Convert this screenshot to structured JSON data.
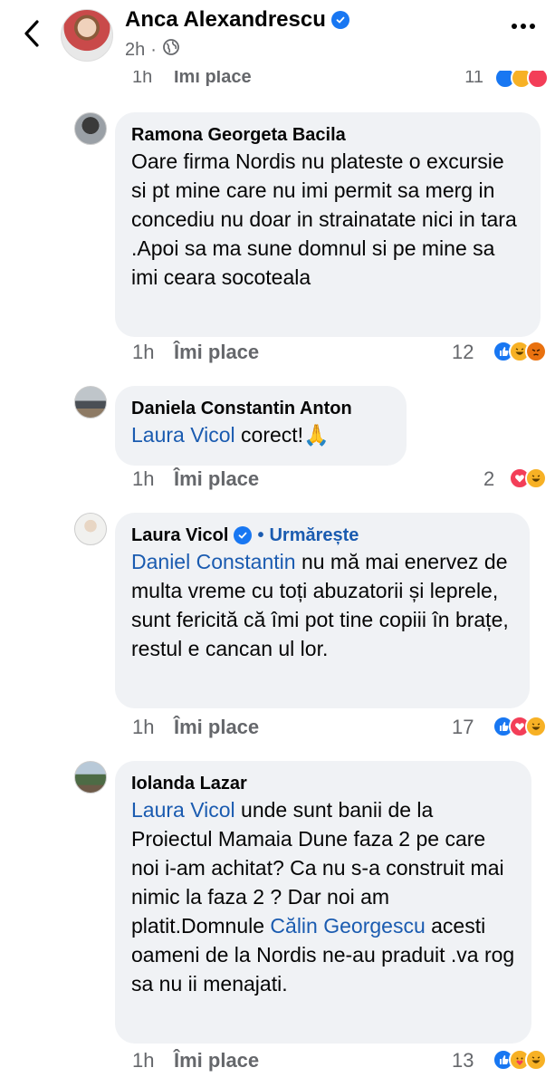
{
  "header": {
    "name": "Anca Alexandrescu",
    "time": "2h",
    "more_label": "More options"
  },
  "cut_row": {
    "time": "1h",
    "like": "Îmi place",
    "count": "11"
  },
  "comments": [
    {
      "author": "Ramona Georgeta Bacila",
      "text": "Oare firma Nordis nu plateste o excursie si pt mine care nu imi permit sa merg in concediu nu doar in strainatate nici in tara .Apoi sa ma sune domnul si pe mine sa imi ceara socoteala",
      "time": "1h",
      "like": "Îmi place",
      "count": "12",
      "reactions": [
        "like",
        "haha",
        "angry"
      ]
    },
    {
      "author": "Daniela Constantin Anton",
      "mention": "Laura Vicol",
      "text": " corect!🙏",
      "time": "1h",
      "like": "Îmi place",
      "count": "2",
      "reactions": [
        "love",
        "haha"
      ]
    },
    {
      "author": "Laura Vicol",
      "follow": "Urmărește",
      "dot": "•",
      "mention": "Daniel Constantin",
      "text": " nu mă mai enervez de multa vreme cu toți abuzatorii și leprele, sunt fericită că îmi pot tine copiii în brațe, restul e cancan ul lor.",
      "time": "1h",
      "like": "Îmi place",
      "count": "17",
      "reactions": [
        "like",
        "love",
        "haha"
      ]
    },
    {
      "author": "Iolanda Lazar",
      "mention": "Laura Vicol",
      "text1": " unde sunt banii de la Proiectul Mamaia Dune faza 2 pe care noi i-am achitat? Ca nu s-a construit mai nimic la faza 2 ? Dar noi am platit.Domnule ",
      "mention2": "Călin Georgescu",
      "text2": "  acesti oameni de la Nordis ne-au praduit .va rog sa nu ii menajati.",
      "time": "1h",
      "like": "Îmi place",
      "count": "13",
      "reactions": [
        "like",
        "care",
        "haha"
      ]
    }
  ],
  "colors": {
    "accent": "#1877f2",
    "bubble": "#f0f2f5",
    "meta": "#65676b",
    "mention": "#1a5bb0"
  },
  "icons": [
    "back-chevron-icon",
    "verified-badge-icon",
    "globe-icon",
    "more-dots-icon",
    "like-reaction-icon",
    "love-reaction-icon",
    "haha-reaction-icon",
    "angry-reaction-icon",
    "care-reaction-icon"
  ]
}
